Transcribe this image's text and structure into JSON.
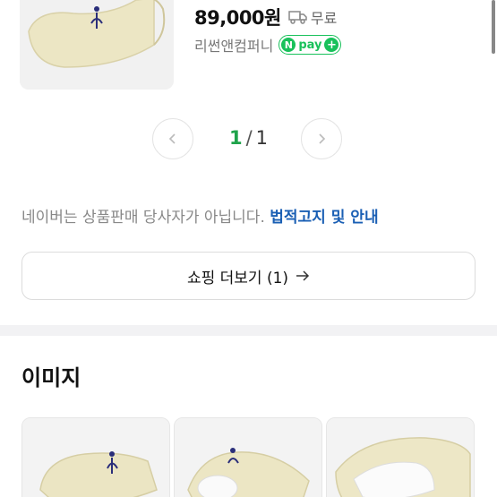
{
  "product": {
    "price": "89,000원",
    "shipping": "무료",
    "seller": "리썬앤컴퍼니",
    "npay_badge_letter": "N",
    "npay_badge_text": "pay",
    "npay_plus": "+",
    "thumbnail_icon": "ballet-shoe-image"
  },
  "pager": {
    "current": "1",
    "separator": "/",
    "total": "1",
    "prev_icon": "chevron-left-icon",
    "next_icon": "chevron-right-icon"
  },
  "notice": {
    "text": "네이버는 상품판매 당사자가 아닙니다.",
    "link": "법적고지 및 안내"
  },
  "more_button": {
    "label": "쇼핑 더보기 (1)",
    "icon": "arrow-right-icon"
  },
  "images_section": {
    "title": "이미지",
    "items": [
      {
        "icon": "ballet-shoe-side-image"
      },
      {
        "icon": "ballet-shoe-sole-image"
      },
      {
        "icon": "ballet-shoe-heel-image"
      }
    ]
  },
  "colors": {
    "npay_green": "#19c15b",
    "pager_current": "#1fa34b",
    "link_blue": "#1a5fb4"
  }
}
